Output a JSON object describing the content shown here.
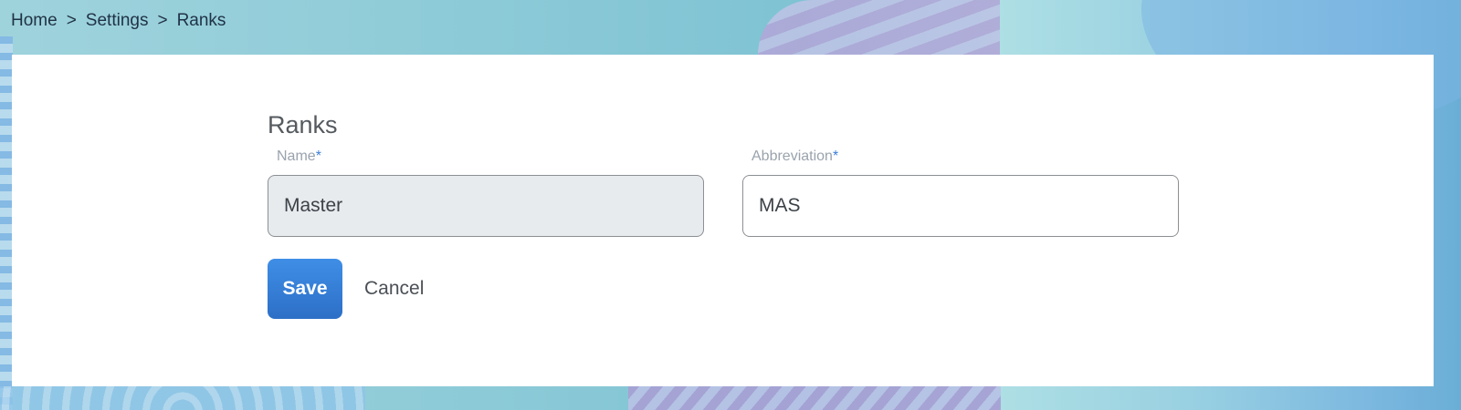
{
  "breadcrumb": {
    "items": [
      "Home",
      "Settings",
      "Ranks"
    ],
    "separator": ">"
  },
  "form": {
    "title": "Ranks",
    "name_field": {
      "label": "Name",
      "required_mark": "*",
      "value": "Master",
      "disabled": true
    },
    "abbreviation_field": {
      "label": "Abbreviation",
      "required_mark": "*",
      "value": "MAS",
      "disabled": false
    },
    "save_label": "Save",
    "cancel_label": "Cancel"
  },
  "colors": {
    "accent": "#2d6fc7",
    "required": "#3d7fd6",
    "background": "#8ecbd8"
  }
}
